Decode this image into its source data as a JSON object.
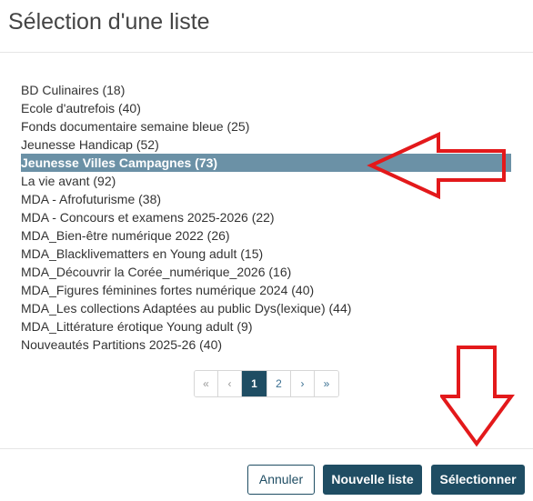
{
  "dialog": {
    "title": "Sélection d'une liste"
  },
  "lists": [
    {
      "label": "BD Culinaires (18)",
      "selected": false
    },
    {
      "label": "Ecole d'autrefois (40)",
      "selected": false
    },
    {
      "label": "Fonds documentaire semaine bleue (25)",
      "selected": false
    },
    {
      "label": "Jeunesse Handicap (52)",
      "selected": false
    },
    {
      "label": "Jeunesse Villes Campagnes (73)",
      "selected": true
    },
    {
      "label": "La vie avant (92)",
      "selected": false
    },
    {
      "label": "MDA - Afrofuturisme (38)",
      "selected": false
    },
    {
      "label": "MDA - Concours et examens 2025-2026 (22)",
      "selected": false
    },
    {
      "label": "MDA_Bien-être numérique 2022 (26)",
      "selected": false
    },
    {
      "label": "MDA_Blacklivematters en Young adult (15)",
      "selected": false
    },
    {
      "label": "MDA_Découvrir la Corée_numérique_2026 (16)",
      "selected": false
    },
    {
      "label": "MDA_Figures féminines fortes numérique 2024 (40)",
      "selected": false
    },
    {
      "label": "MDA_Les collections Adaptées au public Dys(lexique) (44)",
      "selected": false
    },
    {
      "label": "MDA_Littérature érotique Young adult (9)",
      "selected": false
    },
    {
      "label": "Nouveautés Partitions 2025-26 (40)",
      "selected": false
    }
  ],
  "pagination": {
    "first": "«",
    "prev": "‹",
    "pages": [
      "1",
      "2"
    ],
    "current_page": "1",
    "next": "›",
    "last": "»"
  },
  "footer": {
    "cancel_label": "Annuler",
    "new_list_label": "Nouvelle liste",
    "select_label": "Sélectionner"
  },
  "colors": {
    "primary": "#1f4d63",
    "selected_row": "#6b91a6",
    "annotation_arrow": "#e3191b"
  }
}
